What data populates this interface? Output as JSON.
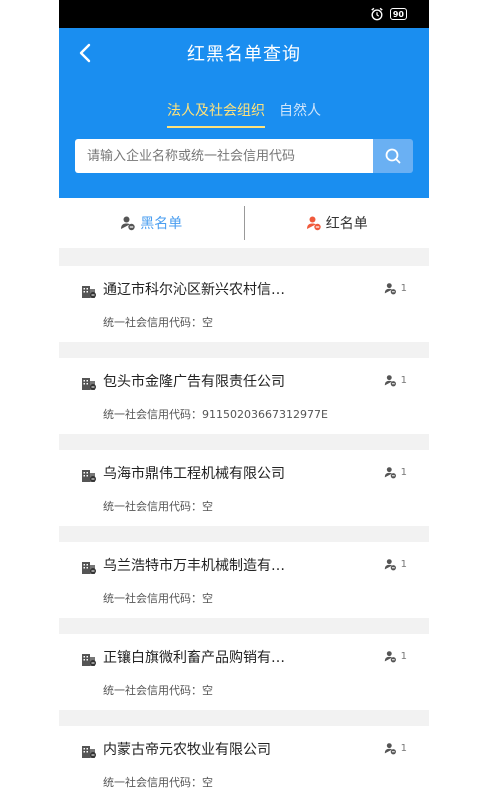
{
  "status_bar": {
    "battery": "90"
  },
  "header": {
    "title": "红黑名单查询",
    "tabs": [
      {
        "label": "法人及社会组织",
        "active": true
      },
      {
        "label": "自然人",
        "active": false
      }
    ]
  },
  "search": {
    "placeholder": "请输入企业名称或统一社会信用代码"
  },
  "segment": {
    "black_label": "黑名单",
    "red_label": "红名单"
  },
  "credit_label": "统一社会信用代码：",
  "items": [
    {
      "name": "通辽市科尔沁区新兴农村信…",
      "code": "空",
      "count": "1"
    },
    {
      "name": "包头市金隆广告有限责任公司",
      "code": "91150203667312977E",
      "count": "1"
    },
    {
      "name": "乌海市鼎伟工程机械有限公司",
      "code": "空",
      "count": "1"
    },
    {
      "name": "乌兰浩特市万丰机械制造有…",
      "code": "空",
      "count": "1"
    },
    {
      "name": "正镶白旗微利畜产品购销有…",
      "code": "空",
      "count": "1"
    },
    {
      "name": "内蒙古帝元农牧业有限公司",
      "code": "空",
      "count": "1"
    }
  ],
  "colors": {
    "header": "#1a8ef0",
    "active_tab": "#ffe27a",
    "black_list": "#4a9ef0",
    "red_list_icon": "#f05a3c"
  },
  "icons": [
    "alarm-icon",
    "battery-icon",
    "back-icon",
    "search-icon",
    "person-minus-icon",
    "building-icon"
  ]
}
